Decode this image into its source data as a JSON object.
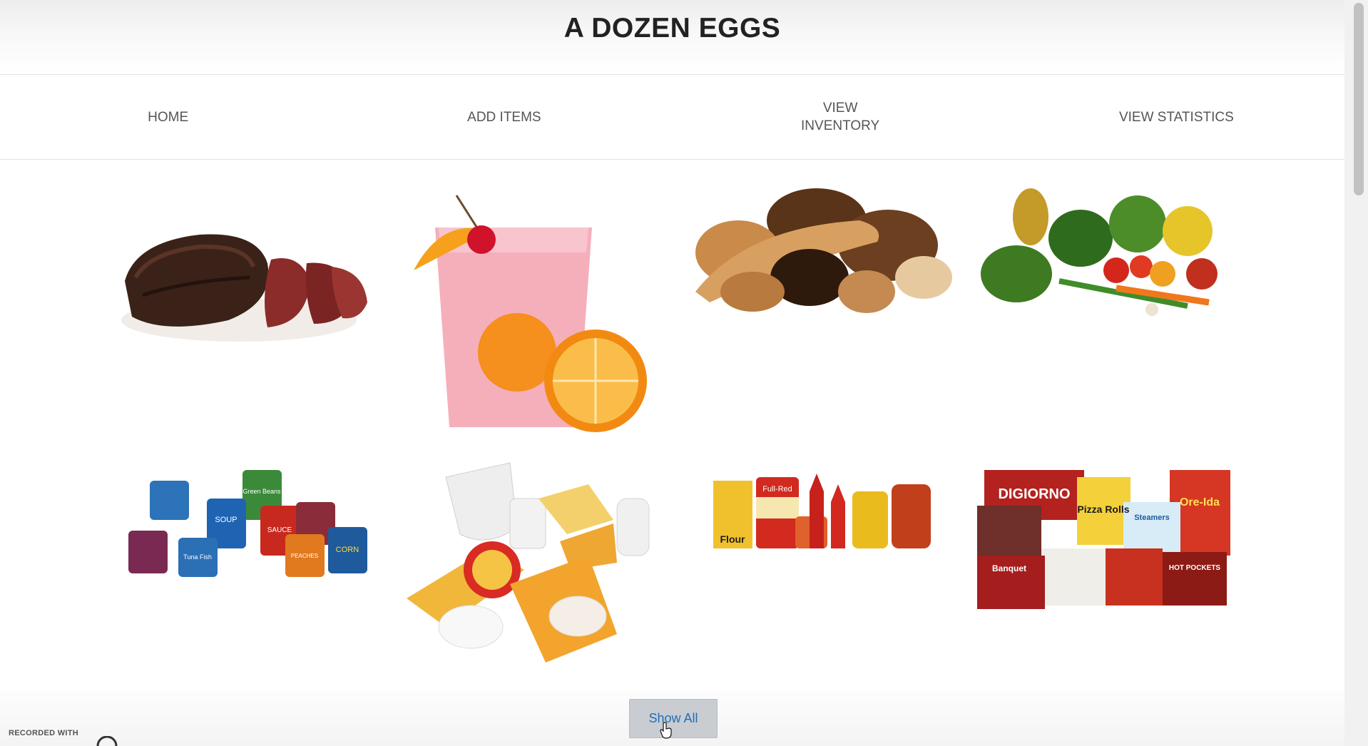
{
  "header": {
    "title": "A DOZEN EGGS"
  },
  "nav": {
    "home": "HOME",
    "add_items": "ADD ITEMS",
    "view_inventory_line1": "VIEW",
    "view_inventory_line2": "INVENTORY",
    "view_statistics": "VIEW STATISTICS"
  },
  "categories": [
    {
      "icon": "meat-icon"
    },
    {
      "icon": "beverage-icon"
    },
    {
      "icon": "bread-icon"
    },
    {
      "icon": "produce-icon"
    },
    {
      "icon": "canned-goods-icon"
    },
    {
      "icon": "dairy-icon"
    },
    {
      "icon": "condiments-icon"
    },
    {
      "icon": "frozen-foods-icon"
    }
  ],
  "labels": {
    "can1": "Green Beans",
    "can2": "SOUP",
    "can3": "SAUCE",
    "can4": "CORN",
    "can5": "PEACHES",
    "can6": "Tuna Fish",
    "flour": "Flour",
    "fullred": "Full-Red",
    "frozen1": "DIGIORNO",
    "frozen2": "Pizza Rolls",
    "frozen3": "Ore-Ida",
    "frozen4": "HOT POCKETS",
    "frozen5": "Banquet",
    "frozen6": "Steamers"
  },
  "actions": {
    "show_all": "Show All"
  },
  "watermark": {
    "recorded_with": "RECORDED WITH"
  }
}
